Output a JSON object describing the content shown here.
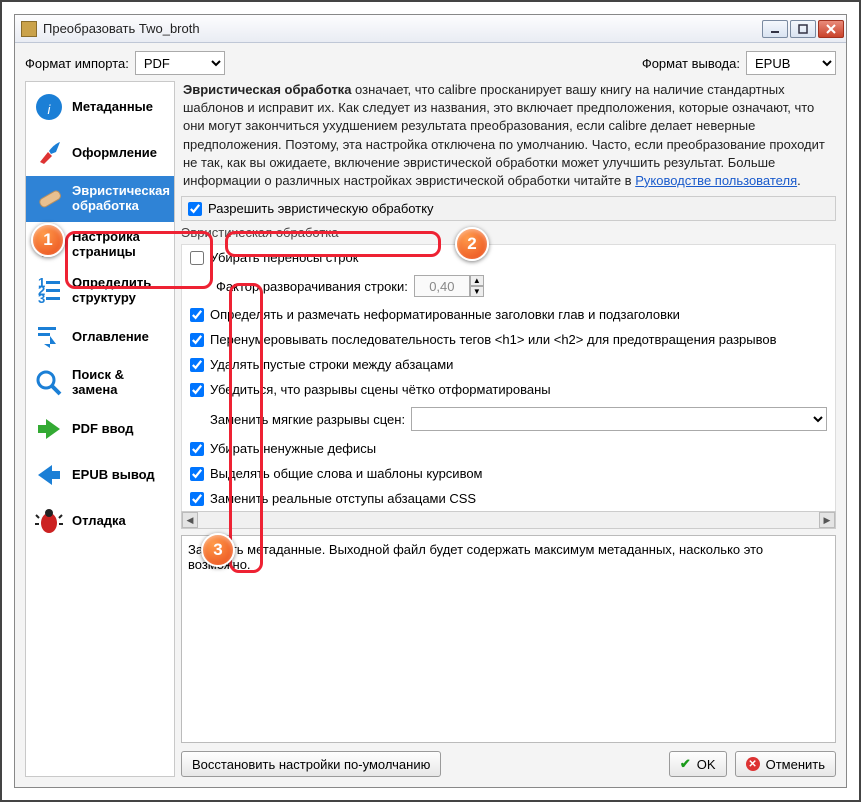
{
  "window": {
    "title": "Преобразовать Two_broth"
  },
  "toolbar": {
    "import_label": "Формат импорта:",
    "import_value": "PDF",
    "output_label": "Формат вывода:",
    "output_value": "EPUB"
  },
  "sidebar": {
    "items": [
      {
        "label": "Метаданные"
      },
      {
        "label": "Оформление"
      },
      {
        "label": "Эвристическая обработка"
      },
      {
        "label": "Настройка страницы"
      },
      {
        "label": "Определить структуру"
      },
      {
        "label": "Оглавление"
      },
      {
        "label": "Поиск & замена"
      },
      {
        "label": "PDF ввод"
      },
      {
        "label": "EPUB вывод"
      },
      {
        "label": "Отладка"
      }
    ]
  },
  "description": {
    "bold_term": "Эвристическая обработка",
    "text_after_bold": " означает, что calibre просканирует вашу книгу на наличие стандартных шаблонов и исправит их. Как следует из названия, это включает предположения, которые означают, что они могут закончиться ухудшением результата преобразования, если calibre делает неверные предположения. Поэтому, эта настройка отключена по умолчанию. Часто, если преобразование проходит не так, как вы ожидаете, включение эвристической обработки может улучшить результат. Больше информации о различных настройках эвристической обработки читайте в ",
    "link_text": "Руководстве пользователя",
    "period": "."
  },
  "enable_checkbox": {
    "label": "Разрешить эвристическую обработку"
  },
  "group_title": "Эвристическая обработка",
  "options": {
    "unwrap_lines": "Убирать переносы строк",
    "unwrap_factor_label": "Фактор разворачивания строки:",
    "unwrap_factor_value": "0,40",
    "markup_headers": "Определять и размечать неформатированные заголовки глав и подзаголовки",
    "renumber_tags": "Перенумеровывать последовательность тегов <h1> или <h2> для предотвращения разрывов",
    "delete_blank": "Удалять пустые строки между абзацами",
    "scene_breaks_fmt": "Убедиться, что разрывы сцены чётко отформатированы",
    "replace_soft_label": "Заменить мягкие разрывы сцен:",
    "remove_hyphens": "Убирать ненужные дефисы",
    "italicize": "Выделять общие слова и шаблоны курсивом",
    "css_indents": "Заменить реальные отступы абзацами CSS"
  },
  "log_text": "Записать метаданные. Выходной файл будет содержать максимум метаданных, насколько это возможно.",
  "buttons": {
    "restore_defaults": "Восстановить настройки по-умолчанию",
    "ok": "OK",
    "cancel": "Отменить"
  },
  "callouts": {
    "one": "1",
    "two": "2",
    "three": "3"
  }
}
